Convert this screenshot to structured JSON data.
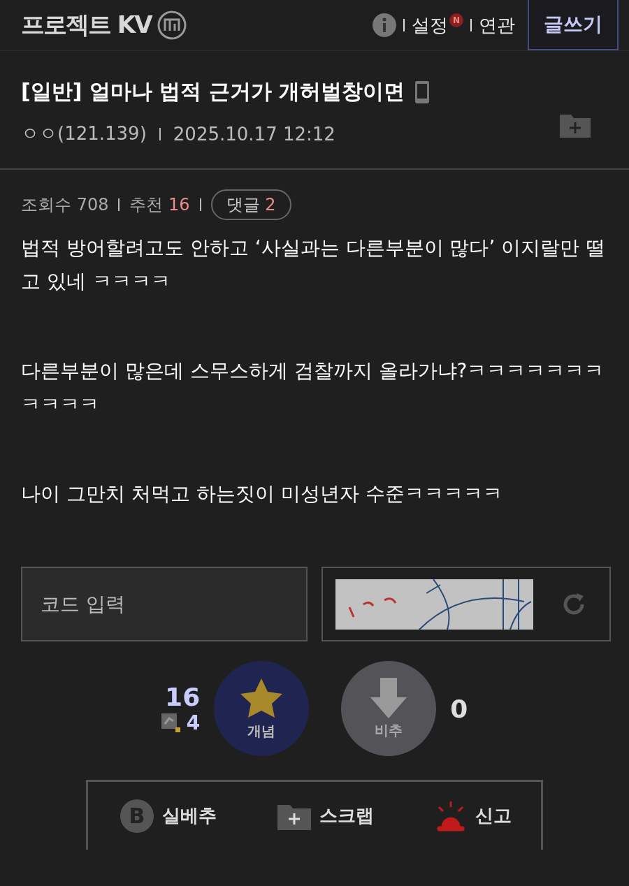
{
  "header": {
    "logo": "프로젝트 KV",
    "nav": [
      {
        "label": "설정",
        "badge": "N"
      },
      {
        "label": "연관"
      }
    ],
    "write_button": "글쓰기"
  },
  "post": {
    "title": "[일반] 얼마나 법적 근거가 개허벌창이면",
    "author": "ㅇㅇ(121.139)",
    "date": "2025.10.17 12:12",
    "stats": [
      {
        "label": "조회수",
        "value": "708",
        "kind": "plain"
      },
      {
        "label": "추천",
        "value": "16",
        "kind": "highlight"
      },
      {
        "label": "댓글",
        "value": "2",
        "kind": "pill"
      }
    ],
    "paragraphs": [
      "법적 방어할려고도 안하고 ‘사실과는 다른부분이 많다’ 이지랄만 떨고 있네 ㅋㅋㅋㅋ",
      "다른부분이 많은데 스무스하게 검찰까지 올라가냐?ㅋㅋㅋㅋㅋㅋㅋㅋㅋㅋㅋ",
      "나이 그만치 처먹고 하는짓이 미성년자 수준ㅋㅋㅋㅋㅋ"
    ]
  },
  "captcha": {
    "placeholder": "코드 입력"
  },
  "votes": {
    "up_count": "16",
    "fixed_count": "4",
    "up_label": "개념",
    "down_label": "비추",
    "down_count": "0"
  },
  "actions": [
    {
      "kind": "best",
      "icon_text": "B",
      "label": "실베추"
    },
    {
      "kind": "scrap",
      "label": "스크랩"
    },
    {
      "kind": "report",
      "label": "신고"
    }
  ]
}
